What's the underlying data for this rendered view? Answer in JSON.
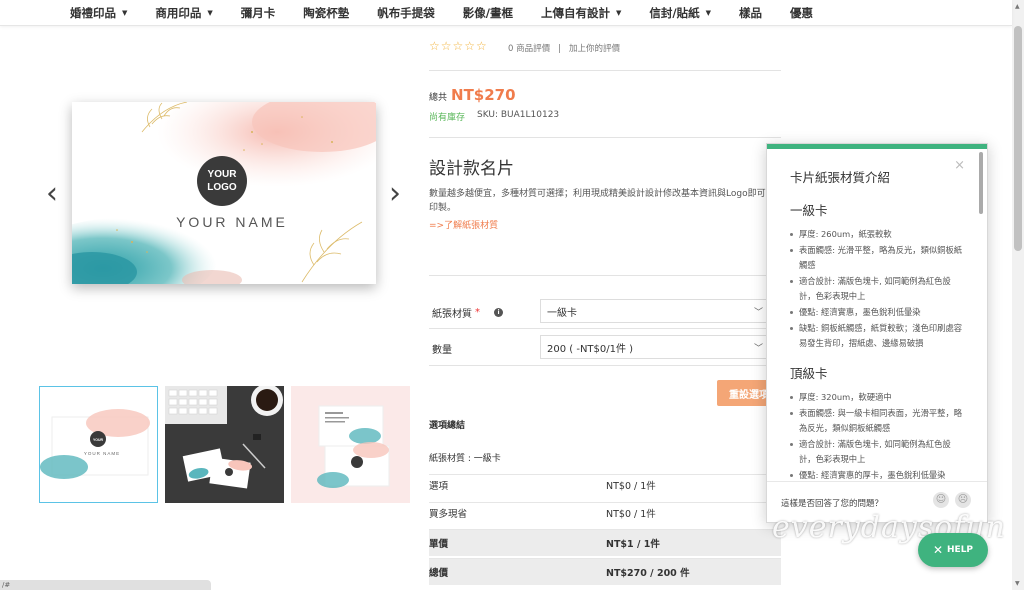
{
  "nav": {
    "items": [
      {
        "label": "婚禮印品",
        "caret": true
      },
      {
        "label": "商用印品",
        "caret": true
      },
      {
        "label": "彌月卡",
        "caret": false
      },
      {
        "label": "陶瓷杯墊",
        "caret": false
      },
      {
        "label": "帆布手提袋",
        "caret": false
      },
      {
        "label": "影像/畫框",
        "caret": false
      },
      {
        "label": "上傳自有設計",
        "caret": true
      },
      {
        "label": "信封/貼紙",
        "caret": true
      },
      {
        "label": "樣品",
        "caret": false
      },
      {
        "label": "優惠",
        "caret": false
      }
    ]
  },
  "gallery": {
    "prev_arrow": "‹",
    "next_arrow": "›",
    "card_logo_line1": "YOUR",
    "card_logo_line2": "LOGO",
    "card_name": "YOUR NAME"
  },
  "reviews": {
    "stars": "☆☆☆☆☆",
    "count_text": "0 商品評價",
    "separator": "|",
    "add_review": "加上你的評價"
  },
  "price": {
    "total_label": "總共",
    "total_value": "NT$270",
    "stock": "尚有庫存",
    "sku": "SKU: BUA1L10123"
  },
  "product": {
    "title": "設計款名片",
    "description": "數量越多越便宜，多種材質可選擇；利用現成精美設計設計修改基本資訊與Logo即可印製。",
    "link": "=>了解紙張材質"
  },
  "options": {
    "paper_label": "紙張材質",
    "required_mark": "*",
    "info_icon": "i",
    "paper_value": "一級卡",
    "quantity_label": "數量",
    "quantity_value": "200 ( -NT$0/1件 )",
    "reset_label": "重設選項"
  },
  "summary": {
    "title": "選項總結",
    "selection": "紙張材質 : 一級卡",
    "rows": [
      {
        "k": "選項",
        "v": "NT$0 / 1件"
      },
      {
        "k": "買多現省",
        "v": "NT$0 / 1件"
      },
      {
        "k": "單價",
        "v": "NT$1 / 1件"
      },
      {
        "k": "總價",
        "v": "NT$270 / 200 件"
      }
    ]
  },
  "popup": {
    "title": "卡片紙張材質介紹",
    "close": "×",
    "sections": [
      {
        "heading": "一級卡",
        "items": [
          "厚度: 260um，紙張較軟",
          "表面觸感: 光滑平整，略為反光，類似銅板紙觸感",
          "適合設計: 滿版色塊卡, 如同範例為紅色設計，色彩表現中上",
          "優點: 經濟實惠，墨色銳利低暈染",
          "缺點: 銅板紙觸感，紙質較軟；淺色印刷處容易發生背印，摺紙處、邊緣易破損"
        ]
      },
      {
        "heading": "頂級卡",
        "items": [
          "厚度: 320um，軟硬適中",
          "表面觸感: 與一級卡相同表面，光滑平整，略為反光，類似銅板紙觸感",
          "適合設計: 滿版色塊卡, 如同範例為紅色設計，色彩表現中上",
          "優點: 經濟實惠的厚卡，墨色銳利低暈染"
        ]
      }
    ],
    "footer_question": "這樣是否回答了您的問題？",
    "happy_face": "☺",
    "sad_face": "☹"
  },
  "help": {
    "x": "✕",
    "label": "HELP"
  },
  "watermark": "everydaysofun",
  "status_bar": "/#",
  "colors": {
    "accent": "#f07c4c",
    "green": "#3fb37f",
    "stock": "#5cb85c",
    "star": "#f2b33d"
  }
}
